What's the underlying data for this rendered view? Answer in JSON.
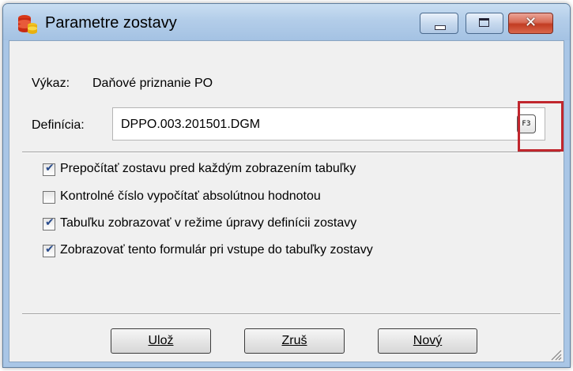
{
  "window": {
    "title": "Parametre zostavy",
    "close_glyph": "✕"
  },
  "form": {
    "vykaz_label": "Výkaz:",
    "vykaz_value": "Daňové priznanie PO",
    "definicia_label": "Definícia:",
    "definicia_value": "DPPO.003.201501.DGM",
    "f3_label": "F3"
  },
  "checkboxes": [
    {
      "label": "Prepočítať zostavu pred každým zobrazením tabuľky",
      "checked": true
    },
    {
      "label": "Kontrolné číslo vypočítať absolútnou hodnotou",
      "checked": false
    },
    {
      "label": "Tabuľku zobrazovať v režime úpravy definícii zostavy",
      "checked": true
    },
    {
      "label": "Zobrazovať tento formulár pri vstupe do tabuľky zostavy",
      "checked": true
    }
  ],
  "buttons": {
    "save": "Ulož",
    "cancel": "Zruš",
    "new": "Nový"
  },
  "colors": {
    "highlight": "#c0262d",
    "titlebar": "#b3cde9",
    "close_button": "#c23c22"
  }
}
